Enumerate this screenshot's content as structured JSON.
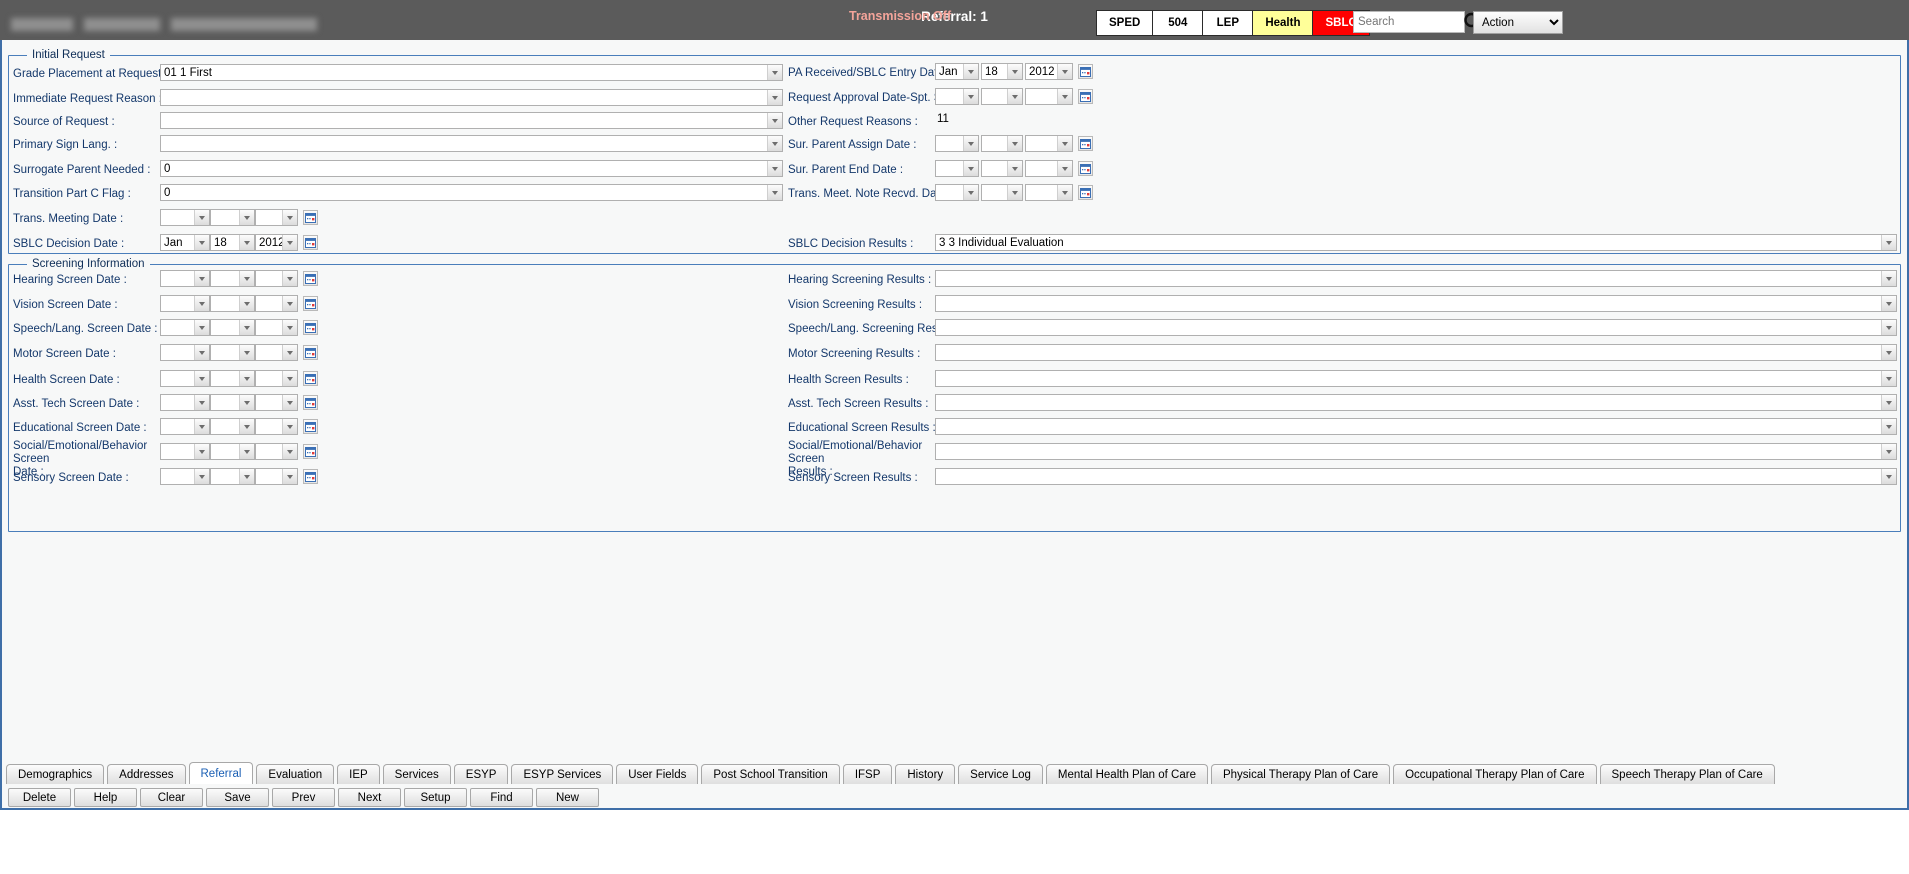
{
  "header": {
    "record_title": "Referral: 1",
    "transmission_status": "Transmission\nOff",
    "transmission_color": "#f4a49a",
    "mode_buttons": [
      {
        "label": "SPED",
        "style": "plain"
      },
      {
        "label": "504",
        "style": "plain"
      },
      {
        "label": "LEP",
        "style": "plain"
      },
      {
        "label": "Health",
        "style": "health",
        "color": "#ffff99"
      },
      {
        "label": "SBLC",
        "style": "sblc",
        "color": "#ff0000"
      }
    ],
    "search": {
      "placeholder": "Search",
      "value": "",
      "icon": "search-icon"
    },
    "action_select": {
      "value": "Action"
    }
  },
  "initial_request": {
    "legend": "Initial Request",
    "left_fields": [
      {
        "label": "Grade Placement at Request :",
        "type": "select",
        "value": "01 1 First"
      },
      {
        "label": "Immediate Request Reason :",
        "type": "select",
        "value": ""
      },
      {
        "label": "Source of Request :",
        "type": "select",
        "value": ""
      },
      {
        "label": "Primary Sign Lang. :",
        "type": "select",
        "value": ""
      },
      {
        "label": "Surrogate Parent Needed :",
        "type": "select",
        "value": "0"
      },
      {
        "label": "Transition Part C Flag :",
        "type": "select",
        "value": "0"
      },
      {
        "label": "Trans. Meeting Date :",
        "type": "date",
        "month": "",
        "day": "",
        "year": ""
      },
      {
        "label": "SBLC Decision Date :",
        "type": "date",
        "month": "Jan",
        "day": "18",
        "year": "2012"
      }
    ],
    "right_fields": [
      {
        "label": "PA Received/SBLC Entry Date :",
        "type": "date",
        "month": "Jan",
        "day": "18",
        "year": "2012"
      },
      {
        "label": "Request Approval Date-Spt. Serv. :",
        "type": "date",
        "month": "",
        "day": "",
        "year": ""
      },
      {
        "label": "Other Request Reasons :",
        "type": "text",
        "value": "11"
      },
      {
        "label": "Sur. Parent Assign Date :",
        "type": "date",
        "month": "",
        "day": "",
        "year": ""
      },
      {
        "label": "Sur. Parent End Date :",
        "type": "date",
        "month": "",
        "day": "",
        "year": ""
      },
      {
        "label": "Trans. Meet. Note Recvd. Date :",
        "type": "date",
        "month": "",
        "day": "",
        "year": ""
      }
    ],
    "decision_results": {
      "label": "SBLC Decision Results :",
      "value": "3 3 Individual Evaluation"
    }
  },
  "screening_information": {
    "legend": "Screening Information",
    "date_fields": [
      {
        "label": "Hearing Screen Date :",
        "month": "",
        "day": "",
        "year": ""
      },
      {
        "label": "Vision Screen Date :",
        "month": "",
        "day": "",
        "year": ""
      },
      {
        "label": "Speech/Lang. Screen Date :",
        "month": "",
        "day": "",
        "year": ""
      },
      {
        "label": "Motor Screen Date :",
        "month": "",
        "day": "",
        "year": ""
      },
      {
        "label": "Health Screen Date :",
        "month": "",
        "day": "",
        "year": ""
      },
      {
        "label": "Asst. Tech Screen Date :",
        "month": "",
        "day": "",
        "year": ""
      },
      {
        "label": "Educational Screen Date :",
        "month": "",
        "day": "",
        "year": ""
      },
      {
        "label": "Social/Emotional/Behavior Screen\nDate :",
        "month": "",
        "day": "",
        "year": ""
      },
      {
        "label": "Sensory Screen Date :",
        "month": "",
        "day": "",
        "year": ""
      }
    ],
    "result_fields": [
      {
        "label": "Hearing Screening Results :",
        "value": ""
      },
      {
        "label": "Vision Screening Results :",
        "value": ""
      },
      {
        "label": "Speech/Lang. Screening Results :",
        "value": ""
      },
      {
        "label": "Motor Screening Results :",
        "value": ""
      },
      {
        "label": "Health Screen Results :",
        "value": ""
      },
      {
        "label": "Asst. Tech Screen Results :",
        "value": ""
      },
      {
        "label": "Educational Screen Results :",
        "value": ""
      },
      {
        "label": "Social/Emotional/Behavior Screen\nResults :",
        "value": ""
      },
      {
        "label": "Sensory Screen Results :",
        "value": ""
      }
    ]
  },
  "tabs": {
    "active": "Referral",
    "items": [
      "Demographics",
      "Addresses",
      "Referral",
      "Evaluation",
      "IEP",
      "Services",
      "ESYP",
      "ESYP Services",
      "User Fields",
      "Post School Transition",
      "IFSP",
      "History",
      "Service Log",
      "Mental Health Plan of Care",
      "Physical Therapy Plan of Care",
      "Occupational Therapy Plan of Care",
      "Speech Therapy Plan of Care"
    ]
  },
  "action_buttons": [
    "Delete",
    "Help",
    "Clear",
    "Save",
    "Prev",
    "Next",
    "Setup",
    "Find",
    "New"
  ]
}
